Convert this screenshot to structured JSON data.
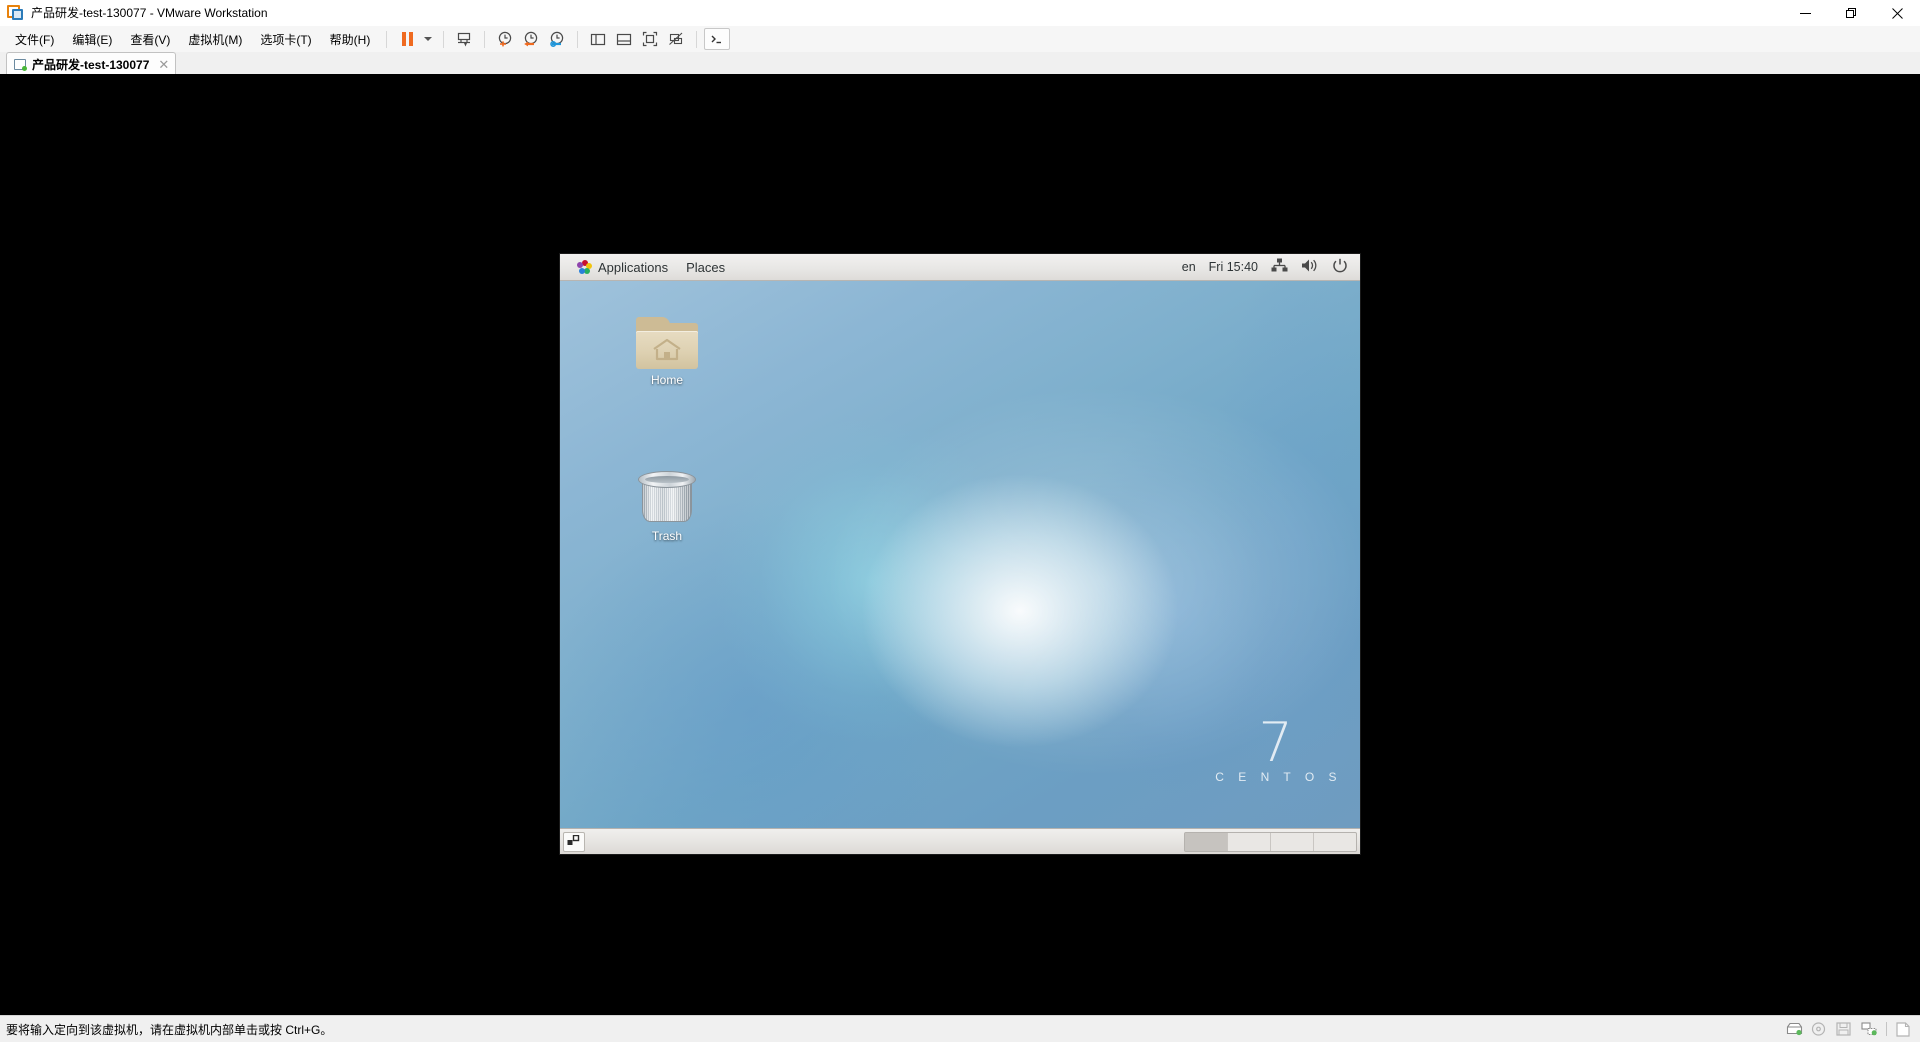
{
  "window": {
    "title": "产品研发-test-130077 - VMware Workstation",
    "app_icon": "vmware-workstation-icon",
    "controls": {
      "minimize": "—",
      "restore": "❐",
      "close": "✕"
    }
  },
  "menubar": {
    "items": [
      {
        "label": "文件(F)",
        "name": "menu-file"
      },
      {
        "label": "编辑(E)",
        "name": "menu-edit"
      },
      {
        "label": "查看(V)",
        "name": "menu-view"
      },
      {
        "label": "虚拟机(M)",
        "name": "menu-vm"
      },
      {
        "label": "选项卡(T)",
        "name": "menu-tabs"
      },
      {
        "label": "帮助(H)",
        "name": "menu-help"
      }
    ]
  },
  "toolbar": {
    "accent_color": "#ef6a20",
    "buttons": [
      {
        "name": "suspend-button",
        "icon": "pause-icon",
        "tooltip": "挂起"
      },
      {
        "name": "power-dropdown-button",
        "icon": "chevron-down-icon"
      },
      {
        "name": "manage-snapshot-button",
        "icon": "snapshot-icon"
      },
      {
        "name": "take-snapshot-button",
        "icon": "clock-plus-icon"
      },
      {
        "name": "revert-snapshot-button",
        "icon": "clock-back-icon"
      },
      {
        "name": "snapshot-manager-button",
        "icon": "clock-settings-icon"
      },
      {
        "name": "show-library-button",
        "icon": "panel-left-icon"
      },
      {
        "name": "show-thumbnail-bar-button",
        "icon": "panel-bottom-icon"
      },
      {
        "name": "fullscreen-button",
        "icon": "fullscreen-icon"
      },
      {
        "name": "unity-mode-button",
        "icon": "unity-mode-icon"
      },
      {
        "name": "console-button",
        "icon": "terminal-icon"
      }
    ]
  },
  "tabs": [
    {
      "label": "产品研发-test-130077",
      "name": "vm-tab-product-rd",
      "active": true,
      "close_label": "✕",
      "state_icon": "vm-powered-on-icon"
    }
  ],
  "guest": {
    "os": "CentOS 7",
    "top_panel": {
      "applications_label": "Applications",
      "places_label": "Places",
      "keyboard_layout": "en",
      "clock": "Fri 15:40",
      "tray": [
        {
          "name": "network-icon",
          "icon": "network-wired-icon"
        },
        {
          "name": "volume-icon",
          "icon": "speaker-icon"
        },
        {
          "name": "power-icon",
          "icon": "power-icon"
        }
      ]
    },
    "desktop_icons": [
      {
        "label": "Home",
        "name": "desktop-icon-home",
        "icon": "home-folder-icon"
      },
      {
        "label": "Trash",
        "name": "desktop-icon-trash",
        "icon": "trash-can-icon"
      }
    ],
    "branding": {
      "version": "7",
      "name": "C E N T O S"
    },
    "bottom_panel": {
      "show_desktop_label": "show-desktop",
      "workspaces": [
        {
          "name": "workspace-1",
          "active": true
        },
        {
          "name": "workspace-2",
          "active": false
        },
        {
          "name": "workspace-3",
          "active": false
        },
        {
          "name": "workspace-4",
          "active": false
        }
      ]
    }
  },
  "statusbar": {
    "message": "要将输入定向到该虚拟机，请在虚拟机内部单击或按 Ctrl+G。",
    "devices": [
      {
        "name": "status-hard-disk-icon",
        "icon": "hard-disk-icon",
        "connected": true
      },
      {
        "name": "status-cd-dvd-icon",
        "icon": "cd-dvd-icon",
        "connected": false
      },
      {
        "name": "status-floppy-icon",
        "icon": "floppy-icon",
        "connected": false
      },
      {
        "name": "status-network-icon",
        "icon": "network-adapter-icon",
        "connected": true
      },
      {
        "name": "status-printer-icon",
        "icon": "printer-icon",
        "connected": false
      }
    ]
  }
}
